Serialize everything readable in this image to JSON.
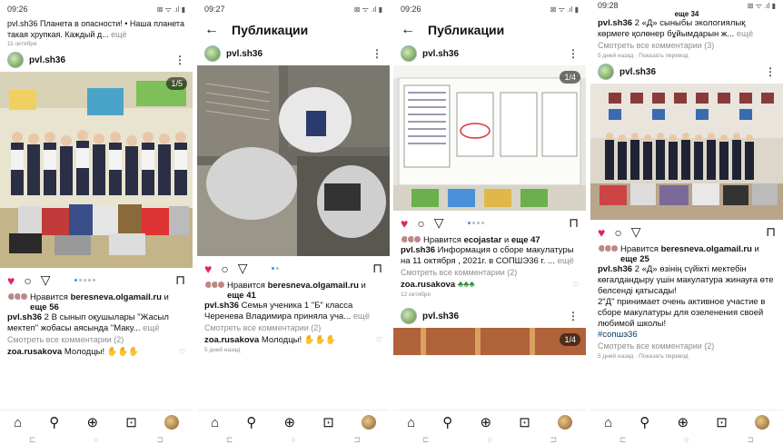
{
  "nav_icons": [
    "home-icon",
    "search-icon",
    "add-icon",
    "shop-icon",
    "profile-avatar"
  ],
  "panels": {
    "p1": {
      "time": "09:26",
      "status_icons": "⊠ ᯤ .ıl ▮",
      "top_cut_text": "",
      "prev_caption": "pvl.sh36 Планета в опасности! • Наша планета такая хрупкая. Каждый д...",
      "prev_more": "ещё",
      "prev_date": "11 октября",
      "author": "pvl.sh36",
      "counter": "1/5",
      "likes_by": "Нравится",
      "likes_user": "beresneva.olgamail.ru",
      "likes_and": "и",
      "likes_more": "еще 56",
      "caption_user": "pvl.sh36",
      "caption": "2 В сынып оқушылары \"Жасыл мектеп\" жобасы аясында \"Маку...",
      "caption_more": "ещё",
      "view_comments": "Смотреть все комментарии (2)",
      "comment_user": "zoa.rusakova",
      "comment_text": "Молодцы!"
    },
    "p2": {
      "time": "09:27",
      "status_icons": "⊠ ᯤ .ıl ▮",
      "title": "Публикации",
      "author": "pvl.sh36",
      "likes_by": "Нравится",
      "likes_user": "beresneva.olgamail.ru",
      "likes_and": "и",
      "likes_more": "еще 41",
      "caption_user": "pvl.sh36",
      "caption": "Семья ученика 1 \"Б\" класса Черенева Владимира приняла уча...",
      "caption_more": "ещё",
      "view_comments": "Смотреть все комментарии (2)",
      "comment_user": "zoa.rusakova",
      "comment_text": "Молодцы!",
      "date": "5 дней назад"
    },
    "p3": {
      "time": "09:26",
      "status_icons": "⊠ ᯤ .ıl ▮",
      "title": "Публикации",
      "author": "pvl.sh36",
      "counter": "1/4",
      "likes_by": "Нравится",
      "likes_user": "ecojastar",
      "likes_and": "и",
      "likes_more": "еще 47",
      "caption_user": "pvl.sh36",
      "caption": "Информация о сборе макулатуры на 11 октября , 2021г. в СОПШЭ36 г. ...",
      "caption_more": "ещё",
      "view_comments": "Смотреть все комментарии (2)",
      "comment_user": "zoa.rusakova",
      "date": "12 октября",
      "author2": "pvl.sh36",
      "counter2": "1/4"
    },
    "p4": {
      "time": "09:28",
      "status_icons": "⊠ ᯤ .ıl ▮",
      "top_cut": "еще 34",
      "prev_caption_user": "pvl.sh36",
      "prev_caption": "2 «Д» сыныбы экологиялық көрмеге қолөнер бұйымдарын ж...",
      "prev_more": "ещё",
      "prev_comments": "Смотреть все комментарии (3)",
      "prev_date": "5 дней назад",
      "prev_translate": "Показать перевод",
      "author": "pvl.sh36",
      "likes_by": "Нравится",
      "likes_user": "beresneva.olgamail.ru",
      "likes_and": "и",
      "likes_more": "еще 25",
      "caption_user": "pvl.sh36",
      "caption_kz": "2 «Д» өзінің сүйікті мектебін көгалдандыру үшін макулатура жинауға өте белсенді қатысады!",
      "caption_ru": "2\"Д\" принимает очень активное участие в сборе макулатуры для озеленения своей любимой школы!",
      "hashtag": "#сопшэ36",
      "view_comments": "Смотреть все комментарии (2)",
      "date": "5 дней назад",
      "translate": "Показать перевод"
    }
  }
}
